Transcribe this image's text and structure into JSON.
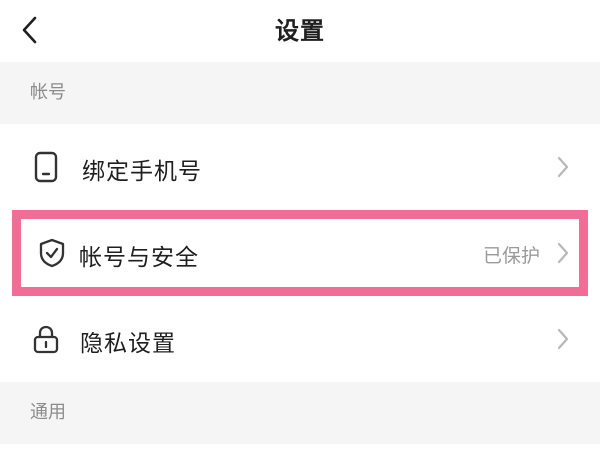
{
  "header": {
    "title": "设置",
    "back_icon": "back-chevron-icon"
  },
  "sections": {
    "account": {
      "label": "帐号",
      "items": [
        {
          "label": "绑定手机号",
          "icon": "phone-icon",
          "status": ""
        },
        {
          "label": "帐号与安全",
          "icon": "shield-check-icon",
          "status": "已保护",
          "highlighted": true
        },
        {
          "label": "隐私设置",
          "icon": "lock-icon",
          "status": ""
        }
      ]
    },
    "general": {
      "label": "通用"
    }
  },
  "colors": {
    "highlight_border": "#f26d95",
    "background": "#f5f5f5",
    "text_primary": "#1f1f1f",
    "text_secondary": "#8c8c8c",
    "chevron": "#b8b8b8"
  }
}
